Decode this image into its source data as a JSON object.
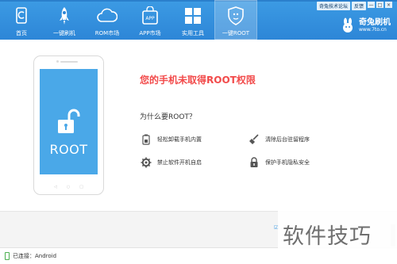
{
  "app": {
    "top_links": {
      "forum": "奇兔技术论坛",
      "feedback": "反馈"
    },
    "window_buttons": [
      "—",
      "□",
      "×"
    ],
    "brand": {
      "name": "奇兔刷机",
      "url": "www.7to.cn"
    }
  },
  "nav": {
    "items": [
      {
        "label": "首页",
        "icon": "home-icon"
      },
      {
        "label": "一键刷机",
        "icon": "rocket-icon"
      },
      {
        "label": "ROM市场",
        "icon": "cloud-icon"
      },
      {
        "label": "APP市场",
        "icon": "app-bag-icon"
      },
      {
        "label": "实用工具",
        "icon": "grid-icon"
      },
      {
        "label": "一键ROOT",
        "icon": "shield-icon"
      }
    ],
    "active_index": 5
  },
  "main": {
    "phone": {
      "screen_text": "ROOT",
      "screen_color": "#4aa8e8"
    },
    "headline": "您的手机未取得ROOT权限",
    "headline_color": "#f24a4a",
    "why_title": "为什么要ROOT？",
    "features": [
      {
        "label": "轻松卸载手机内置",
        "icon": "uninstall-icon"
      },
      {
        "label": "清除后台驻留程序",
        "icon": "broom-icon"
      },
      {
        "label": "禁止软件开机自启",
        "icon": "gear-icon"
      },
      {
        "label": "保护手机隐私安全",
        "icon": "padlock-icon"
      }
    ]
  },
  "status": {
    "connection": "已连接：Android"
  },
  "watermark": {
    "text": "软件技巧"
  },
  "colors": {
    "header": "#2d86d7",
    "accent": "#3c9be4"
  }
}
